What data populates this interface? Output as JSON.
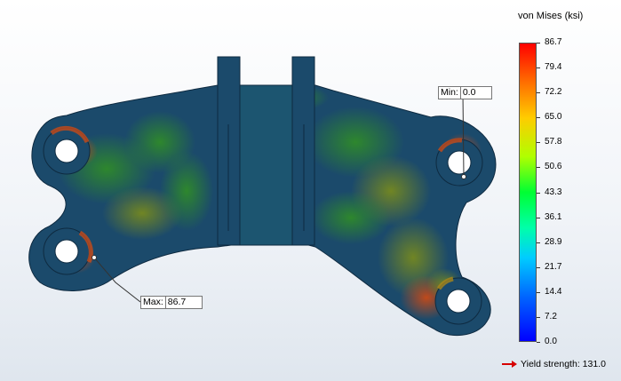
{
  "legend": {
    "title": "von Mises (ksi)",
    "ticks": [
      "86.7",
      "79.4",
      "72.2",
      "65.0",
      "57.8",
      "50.6",
      "43.3",
      "36.1",
      "28.9",
      "21.7",
      "14.4",
      "7.2",
      "0.0"
    ],
    "yield_label": "Yield strength: 131.0"
  },
  "probes": {
    "min": {
      "label": "Min:",
      "value": "0.0"
    },
    "max": {
      "label": "Max:",
      "value": "86.7"
    }
  },
  "colors": {
    "part_base": "#1b4a6b",
    "stress_low": "#1d7a3a",
    "stress_mid": "#6b8a1a",
    "stress_hot": "#c83a1a",
    "yield_arrow": "#d60000"
  }
}
